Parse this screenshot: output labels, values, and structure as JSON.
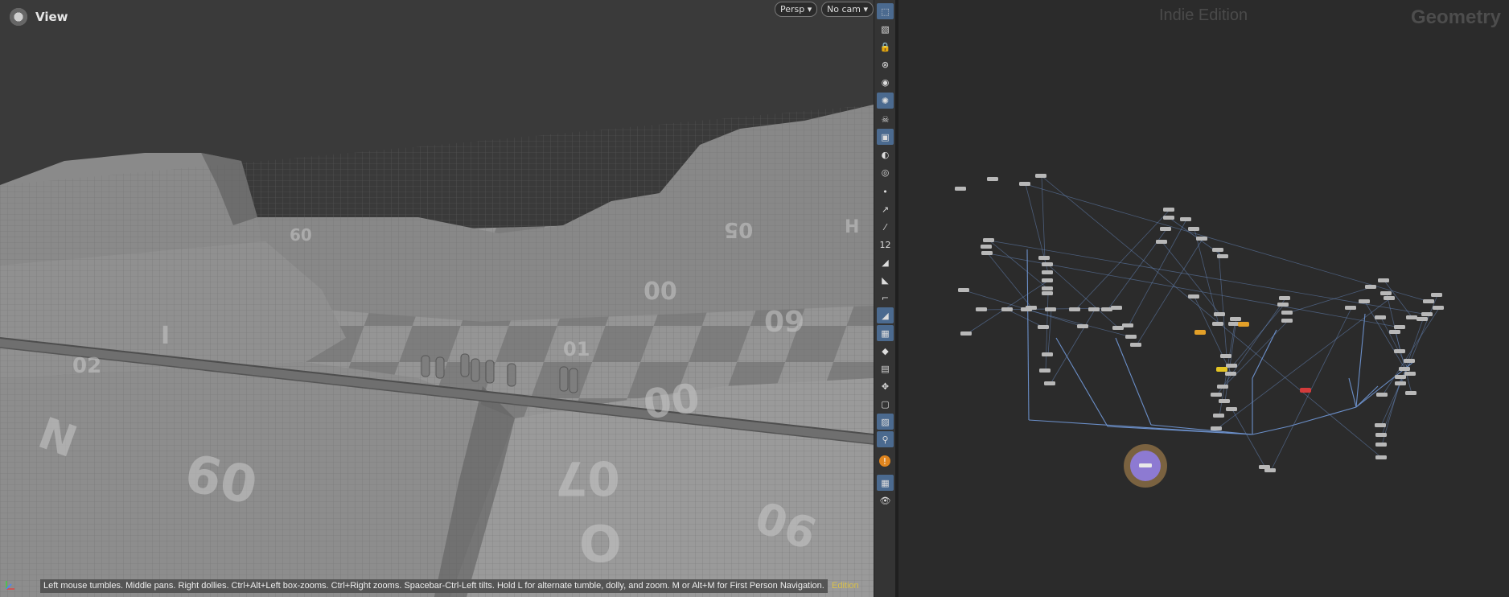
{
  "viewport": {
    "title": "View",
    "persp_label": "Persp",
    "cam_label": "No cam",
    "hint": "Left mouse tumbles. Middle pans. Right dollies. Ctrl+Alt+Left box-zooms. Ctrl+Right zooms. Spacebar-Ctrl-Left tilts. Hold L for alternate tumble, dolly, and zoom. M or Alt+M for First Person Navigation.",
    "edition_small": "Edition",
    "terrain_labels": [
      "60",
      "00",
      "07",
      "90",
      "N",
      "I",
      "09",
      "02",
      "01",
      "00",
      "05",
      "H",
      "O",
      "60"
    ]
  },
  "toolbar": {
    "items": [
      {
        "icon": "select-icon",
        "active": true
      },
      {
        "icon": "display-options-icon",
        "active": false
      },
      {
        "icon": "lock-icon",
        "active": false
      },
      {
        "icon": "hide-icon",
        "active": false
      },
      {
        "icon": "shading-icon",
        "active": false
      },
      {
        "icon": "light-icon",
        "active": true
      },
      {
        "icon": "ghost-icon",
        "active": false
      },
      {
        "icon": "background-icon",
        "active": true
      },
      {
        "icon": "camera-icon",
        "active": false
      },
      {
        "icon": "render-icon",
        "active": false
      },
      {
        "icon": "point-icon",
        "active": false
      },
      {
        "icon": "normal-icon",
        "active": false
      },
      {
        "icon": "vertex-icon",
        "active": false
      },
      {
        "icon": "point-number-icon",
        "active": false,
        "label": "12"
      },
      {
        "icon": "primitive-icon",
        "active": false
      },
      {
        "icon": "primitive-number-icon",
        "active": false
      },
      {
        "icon": "edge-icon",
        "active": false
      },
      {
        "icon": "snap-icon",
        "active": true
      },
      {
        "icon": "uv-icon",
        "active": true
      },
      {
        "icon": "guide-icon",
        "active": false
      },
      {
        "icon": "map-icon",
        "active": false
      },
      {
        "icon": "handle-icon",
        "active": false
      },
      {
        "icon": "viewport-layout-icon",
        "active": false
      },
      {
        "icon": "camera-view-icon",
        "active": true
      },
      {
        "icon": "pin-icon",
        "active": true
      },
      {
        "icon": "warning-icon",
        "active": false
      },
      {
        "icon": "grid-icon",
        "active": true
      },
      {
        "icon": "eye-icon",
        "active": false
      }
    ]
  },
  "network": {
    "edition": "Indie Edition",
    "context": "Geometry",
    "node_color": "#b8b8b8",
    "wire_color": "#6b8fc9",
    "display_color": "#8d7ad2",
    "warning_color": "#e3a028",
    "error_color": "#d33b3b"
  }
}
